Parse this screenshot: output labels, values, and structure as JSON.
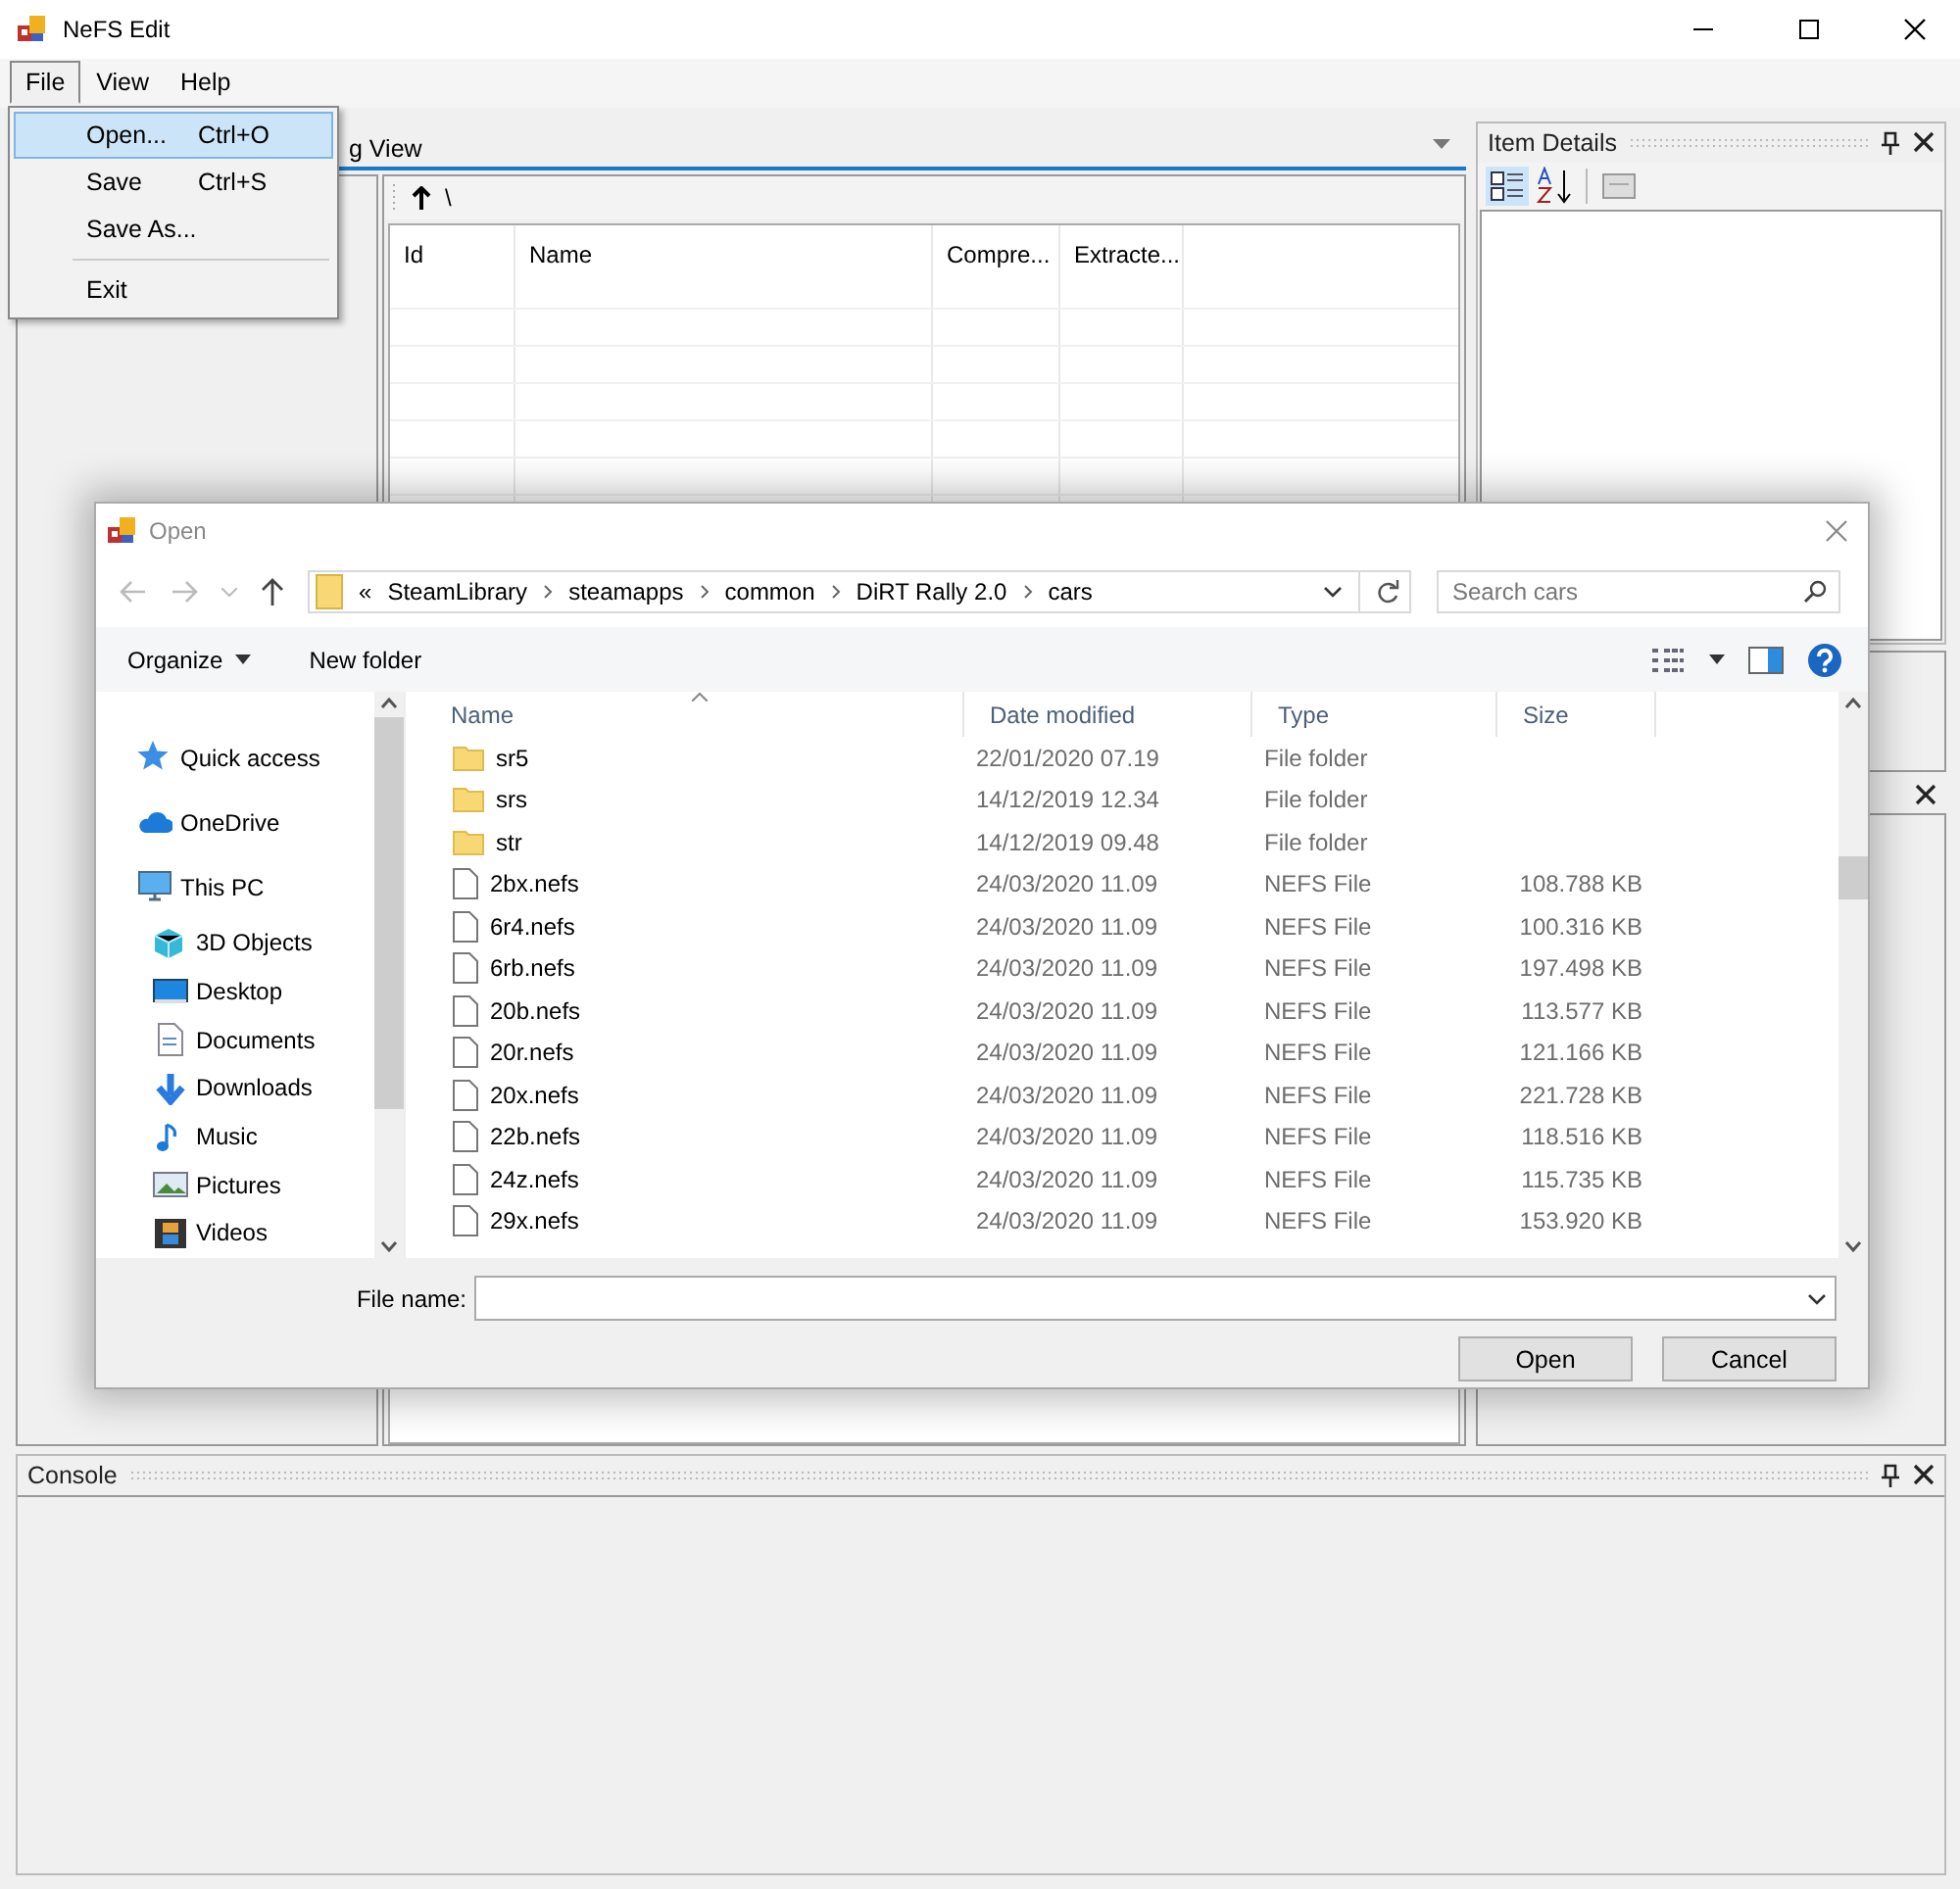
{
  "window": {
    "title": "NeFS Edit"
  },
  "menu_bar": [
    {
      "label": "File",
      "selected": true
    },
    {
      "label": "View",
      "selected": false
    },
    {
      "label": "Help",
      "selected": false
    }
  ],
  "file_menu": [
    {
      "kind": "item",
      "label": "Open...",
      "shortcut": "Ctrl+O",
      "selected": true
    },
    {
      "kind": "item",
      "label": "Save",
      "shortcut": "Ctrl+S",
      "selected": false
    },
    {
      "kind": "item",
      "label": "Save As...",
      "selected": false
    },
    {
      "kind": "separator"
    },
    {
      "kind": "item",
      "label": "Exit",
      "selected": false
    }
  ],
  "listing": {
    "tab": "g View",
    "path": "\\",
    "columns": [
      "Id",
      "Name",
      "Compre...",
      "Extracte..."
    ]
  },
  "item_details": {
    "title": "Item Details"
  },
  "console": {
    "title": "Console"
  },
  "dialog": {
    "title": "Open",
    "breadcrumb": [
      "«",
      "SteamLibrary",
      "steamapps",
      "common",
      "DiRT Rally 2.0",
      "cars"
    ],
    "search": {
      "placeholder": "Search cars"
    },
    "commands": [
      "Organize",
      "New folder"
    ],
    "nav": [
      {
        "label": "Quick access",
        "kind": "star"
      },
      {
        "label": "OneDrive",
        "kind": "cloud"
      },
      {
        "label": "This PC",
        "kind": "pc",
        "children": [
          {
            "label": "3D Objects",
            "kind": "cube"
          },
          {
            "label": "Desktop",
            "kind": "desktop"
          },
          {
            "label": "Documents",
            "kind": "document"
          },
          {
            "label": "Downloads",
            "kind": "download"
          },
          {
            "label": "Music",
            "kind": "music"
          },
          {
            "label": "Pictures",
            "kind": "picture"
          },
          {
            "label": "Videos",
            "kind": "video"
          }
        ]
      }
    ],
    "columns": [
      "Name",
      "Date modified",
      "Type",
      "Size"
    ],
    "files": [
      {
        "kind": "folder",
        "name": "sr5",
        "date": "22/01/2020 07.19",
        "type": "File folder"
      },
      {
        "kind": "folder",
        "name": "srs",
        "date": "14/12/2019 12.34",
        "type": "File folder"
      },
      {
        "kind": "folder",
        "name": "str",
        "date": "14/12/2019 09.48",
        "type": "File folder"
      },
      {
        "kind": "file",
        "name": "2bx.nefs",
        "date": "24/03/2020 11.09",
        "type": "NEFS File",
        "size": "108.788 KB"
      },
      {
        "kind": "file",
        "name": "6r4.nefs",
        "date": "24/03/2020 11.09",
        "type": "NEFS File",
        "size": "100.316 KB"
      },
      {
        "kind": "file",
        "name": "6rb.nefs",
        "date": "24/03/2020 11.09",
        "type": "NEFS File",
        "size": "197.498 KB"
      },
      {
        "kind": "file",
        "name": "20b.nefs",
        "date": "24/03/2020 11.09",
        "type": "NEFS File",
        "size": "113.577 KB"
      },
      {
        "kind": "file",
        "name": "20r.nefs",
        "date": "24/03/2020 11.09",
        "type": "NEFS File",
        "size": "121.166 KB"
      },
      {
        "kind": "file",
        "name": "20x.nefs",
        "date": "24/03/2020 11.09",
        "type": "NEFS File",
        "size": "221.728 KB"
      },
      {
        "kind": "file",
        "name": "22b.nefs",
        "date": "24/03/2020 11.09",
        "type": "NEFS File",
        "size": "118.516 KB"
      },
      {
        "kind": "file",
        "name": "24z.nefs",
        "date": "24/03/2020 11.09",
        "type": "NEFS File",
        "size": "115.735 KB"
      },
      {
        "kind": "file",
        "name": "29x.nefs",
        "date": "24/03/2020 11.09",
        "type": "NEFS File",
        "size": "153.920 KB"
      }
    ],
    "file_name_label": "File name:",
    "buttons": [
      "Open",
      "Cancel"
    ]
  }
}
